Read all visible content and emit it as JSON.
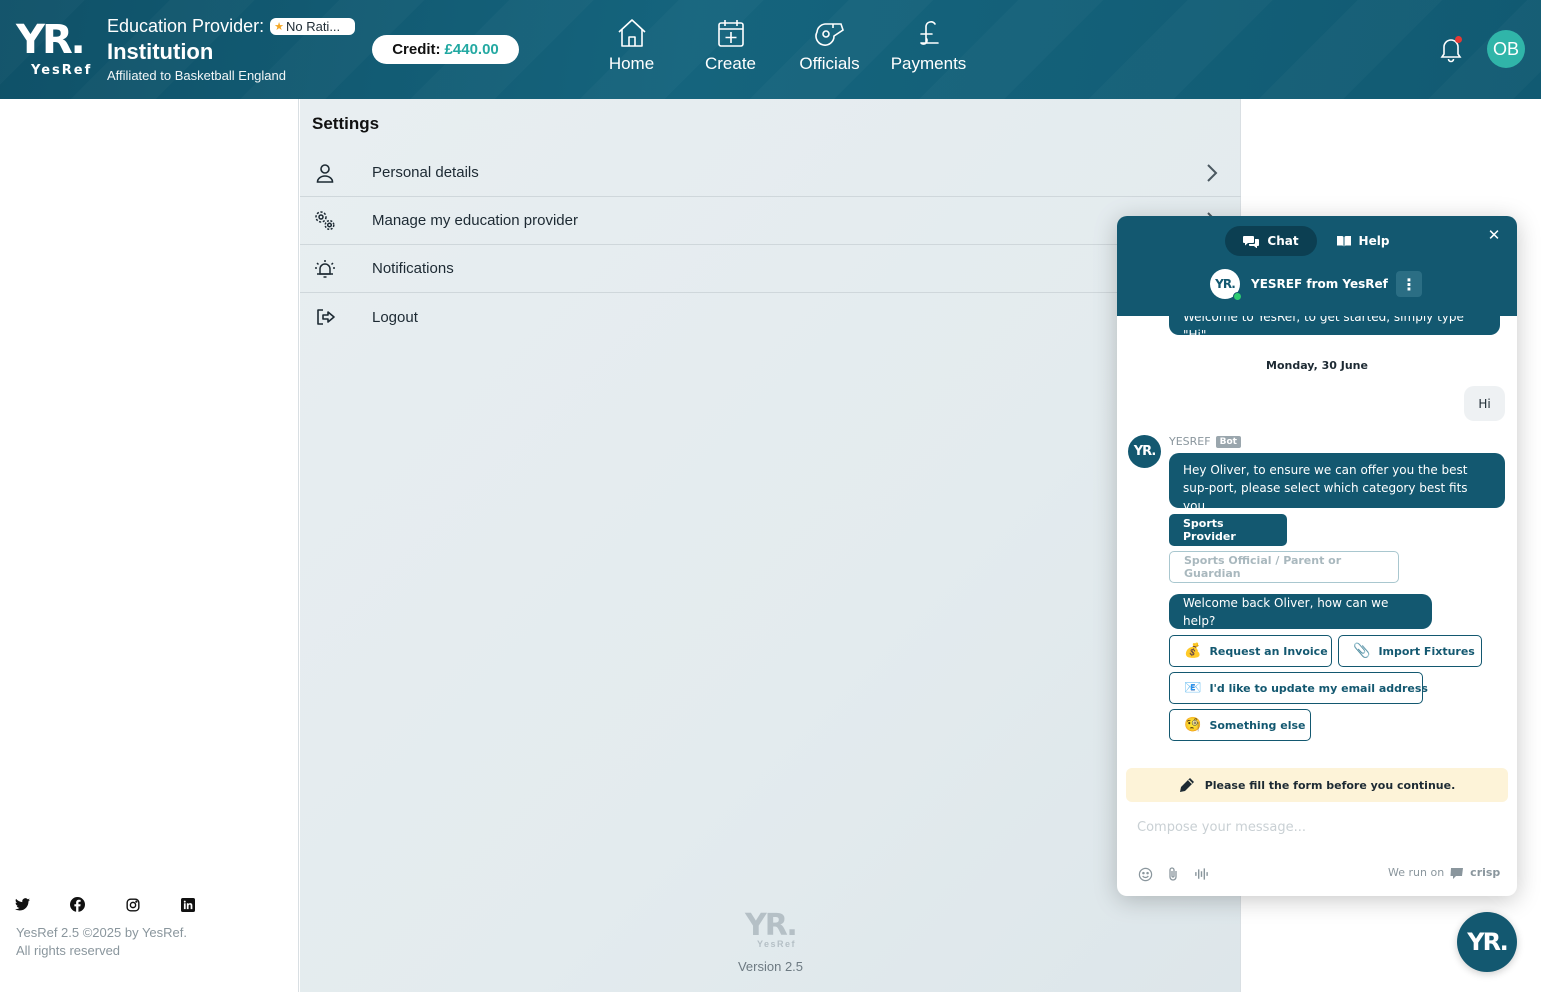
{
  "header": {
    "logo_mark": "YR.",
    "logo_text": "YesRef",
    "provider_label": "Education Provider:",
    "rating_badge": "No Rati...",
    "institution": "Institution",
    "affiliation": "Affiliated to Basketball England",
    "credit_label": "Credit:",
    "credit_amount": "£440.00",
    "nav": [
      {
        "label": "Home",
        "icon": "home-icon"
      },
      {
        "label": "Create",
        "icon": "calendar-plus-icon"
      },
      {
        "label": "Officials",
        "icon": "whistle-icon"
      },
      {
        "label": "Payments",
        "icon": "pound-icon"
      }
    ],
    "avatar_initials": "OB",
    "notification_dot_color": "#e53935"
  },
  "sidebar": {
    "socials": [
      "twitter-icon",
      "facebook-icon",
      "instagram-icon",
      "linkedin-icon"
    ],
    "copyright_line1": "YesRef 2.5 ©2025 by YesRef.",
    "copyright_line2": "All rights reserved"
  },
  "settings": {
    "title": "Settings",
    "items": [
      {
        "label": "Personal details",
        "icon": "user-icon"
      },
      {
        "label": "Manage my education provider",
        "icon": "gears-icon"
      },
      {
        "label": "Notifications",
        "icon": "alarm-bell-icon"
      },
      {
        "label": "Logout",
        "icon": "logout-icon"
      }
    ],
    "footer_logo": "YR.",
    "footer_logo_text": "YesRef",
    "version": "Version 2.5"
  },
  "chat": {
    "tabs": [
      {
        "label": "Chat",
        "icon": "chat-icon"
      },
      {
        "label": "Help",
        "icon": "book-icon"
      }
    ],
    "agent_name": "YESREF from YesRef",
    "agent_avatar": "YR.",
    "cut_message": "Welcome to YesRef, to get started, simply type \"Hi\".",
    "date": "Monday, 30 June",
    "user_message": "Hi",
    "bot_name": "YESREF",
    "bot_tag": "Bot",
    "bot_message_1": "Hey Oliver, to ensure we can offer you the best sup-port, please select which category best fits you...",
    "choice_selected": "Sports Provider",
    "choice_other": "Sports Official / Parent or Guardian",
    "bot_message_2": "Welcome back Oliver, how can we help?",
    "options": [
      {
        "emoji": "💰",
        "label": "Request an Invoice"
      },
      {
        "emoji": "📎",
        "label": "Import Fixtures"
      },
      {
        "emoji": "📧",
        "label": "I'd like to update my email address"
      },
      {
        "emoji": "🧐",
        "label": "Something else"
      }
    ],
    "form_note": "Please fill the form before you continue.",
    "compose_placeholder": "Compose your message...",
    "run_on": "We run on",
    "brand": "crisp",
    "launcher": "YR."
  }
}
